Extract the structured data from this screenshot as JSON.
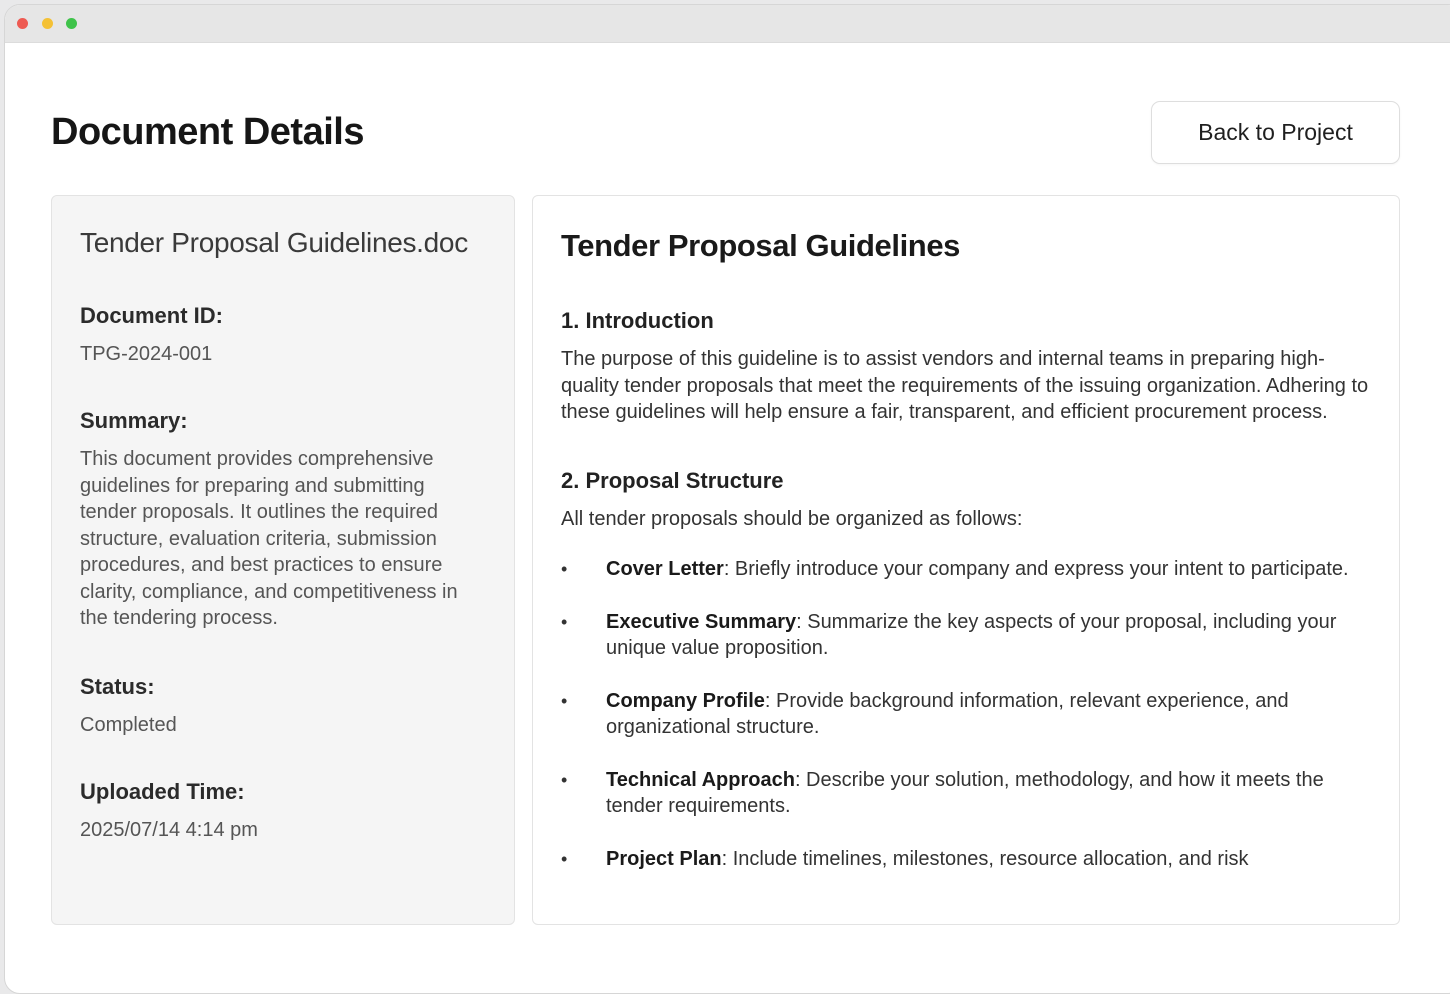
{
  "window": {
    "controls": [
      "close",
      "minimize",
      "maximize"
    ]
  },
  "header": {
    "title": "Document Details",
    "back_button_label": "Back to Project"
  },
  "details": {
    "file_name": "Tender Proposal Guidelines.doc",
    "document_id_label": "Document ID:",
    "document_id_value": "TPG-2024-001",
    "summary_label": "Summary:",
    "summary_value": "This document provides comprehensive guidelines for preparing and submitting tender proposals. It outlines the required structure, evaluation criteria, submission procedures, and best practices to ensure clarity, compliance, and competitiveness in the tendering process.",
    "status_label": "Status:",
    "status_value": "Completed",
    "uploaded_label": "Uploaded Time:",
    "uploaded_value": "2025/07/14 4:14 pm"
  },
  "preview": {
    "title": "Tender Proposal Guidelines",
    "section1_heading": "1. Introduction",
    "section1_body": "The purpose of this guideline is to assist vendors and internal teams in preparing high-quality tender proposals that meet the requirements of the issuing organization. Adhering to these guidelines will help ensure a fair, transparent, and efficient procurement process.",
    "section2_heading": "2. Proposal Structure",
    "section2_intro": "All tender proposals should be organized as follows:",
    "bullet_marker": "•",
    "bullets": [
      {
        "term": "Cover Letter",
        "text": ": Briefly introduce your company and express your intent to participate."
      },
      {
        "term": "Executive Summary",
        "text": ": Summarize the key aspects of your proposal, including your unique value proposition."
      },
      {
        "term": "Company Profile",
        "text": ": Provide background information, relevant experience, and organizational structure."
      },
      {
        "term": "Technical Approach",
        "text": ": Describe your solution, methodology, and how it meets the tender requirements."
      },
      {
        "term": "Project Plan",
        "text": ": Include timelines, milestones, resource allocation, and risk"
      }
    ]
  },
  "colors": {
    "titlebar": "#e6e6e6",
    "close": "#ee5a52",
    "minimize": "#f4c135",
    "maximize": "#3fc34a",
    "left_panel_bg": "#f5f5f5"
  }
}
